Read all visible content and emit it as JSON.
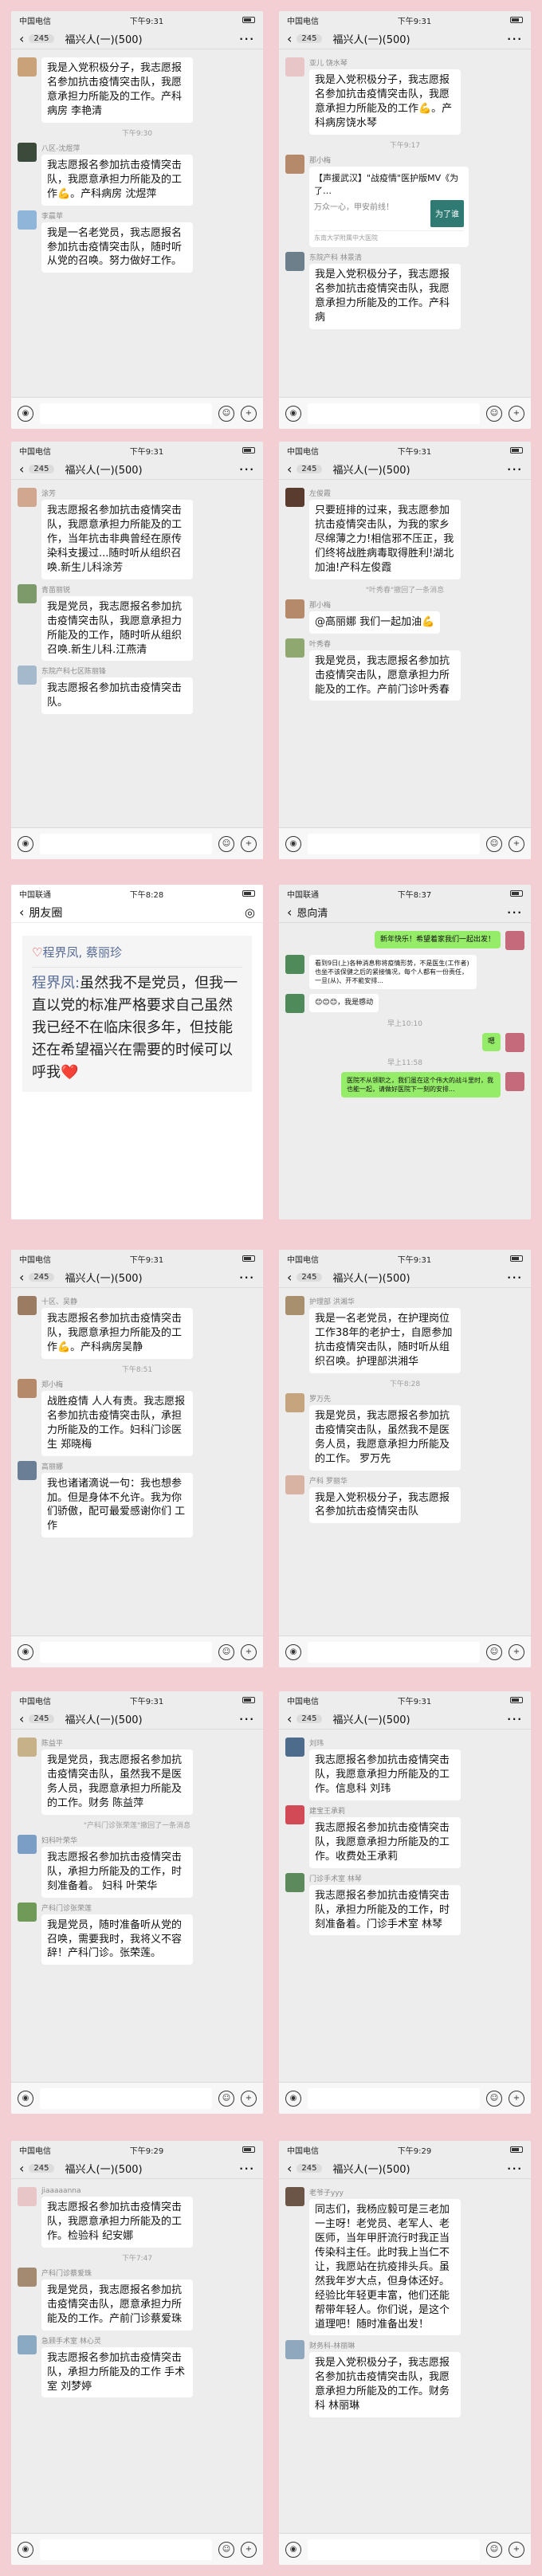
{
  "colors": {
    "background": "#f3cfd3",
    "chat_bg": "#ededed",
    "bubble": "#ffffff",
    "green_bubble": "#95ec69",
    "link": "#576b95"
  },
  "common": {
    "group_title": "福兴人(一)(500)",
    "unread": "245",
    "more": "···",
    "back": "‹",
    "voice_icon": "◉",
    "emoji_icon": "☺",
    "plus_icon": "+"
  },
  "p1": {
    "status_left": "中国电信",
    "time": "下午9:31",
    "m1": "我是入党积极分子，我志愿报名参加抗击疫情突击队，我愿意承担力所能及的工作。产科病房 李艳清",
    "ts1": "下午9:30",
    "n2": "八区-沈煜萍",
    "m2": "我志愿报名参加抗击疫情突击队，我愿意承担力所能及的工作💪。产科病房 沈煜萍",
    "n3": "李晨苹",
    "m3": "我是一名老党员，我志愿报名参加抗击疫情突击队，随时听从党的召唤。努力做好工作。"
  },
  "p2": {
    "status_left": "中国电信",
    "time": "下午9:31",
    "n1": "亚儿 饶水琴",
    "m1": "我是入党积极分子，我志愿报名参加抗击疫情突击队，我愿意承担力所能及的工作💪。产科病房饶水琴",
    "ts1": "下午9:17",
    "n2": "那小梅",
    "card_title": "【声援武汉】\"战疫情\"医护版MV《为了…",
    "card_desc": "万众一心，甲安前线！",
    "card_thumb": "为了谁",
    "card_src": "东南大学附属中大医院",
    "n3": "东院产科 林景清",
    "m3": "我是入党积极分子，我志愿报名参加抗击疫情突击队，我愿意承担力所能及的工作。产科病"
  },
  "p3": {
    "status_left": "中国电信",
    "time": "下午9:31",
    "n1": "涂芳",
    "m1": "我志愿报名参加抗击疫情突击队，我愿意承担力所能及的工作，当年抗击非典曾经在原传染科支援过...随时听从组织召唤.新生儿科涂芳",
    "n2": "青苗丽锐",
    "m2": "我是党员，我志愿报名参加抗击疫情突击队，我愿意承担力所能及的工作，随时听从组织召唤.新生儿科.江燕清",
    "n3": "东院产科七区陈丽锋",
    "m3": "我志愿报名参加抗击疫情突击队。"
  },
  "p4": {
    "status_left": "中国电信",
    "time": "下午9:31",
    "n1": "左俊霞",
    "m1": "只要班排的过来，我志愿参加抗击疫情突击队，为我的家乡尽绵薄之力!相信邪不压正，我们终将战胜病毒取得胜利!湖北加油!产科左俊霞",
    "sys1": "\"叶秀春\"撤回了一条消息",
    "n2": "那小梅",
    "m2": "@高丽娜 我们一起加油💪",
    "n3": "叶秀春",
    "m3": "我是党员，我志愿报名参加抗击疫情突击队，愿意承担力所能及的工作。产前门诊叶秀春"
  },
  "p5": {
    "status_left": "中国联通",
    "time": "下午8:28",
    "title": "朋友圈",
    "camera": "◎",
    "likes": "程界凤, 蔡丽珍",
    "commenter": "程界凤:",
    "comment": "虽然我不是党员，但我一直以党的标准严格要求自己虽然我已经不在临床很多年，但技能还在希望福兴在需要的时候可以呼我❤️"
  },
  "p6": {
    "status_left": "中国联通",
    "time": "下午8:37",
    "title": "恩向清",
    "m1": "新年快乐！希望着家我们一起出发！",
    "m2": "看到9日(上)各种消息称将疫情形势，不是医生(工作者)也坐不该保健之后的紧接情况，每个人都有一份责任，一旦(从)、开不能安排...",
    "m3": "😊😊😊，我是感动",
    "ts1": "早上10:10",
    "m4": "嗯",
    "ts2": "早上11:58",
    "m5": "医院不从领职之，我们虽在这个伟大的战斗里时，我也能一起，请做好医院下一刻的安排..."
  },
  "p7": {
    "status_left": "中国电信",
    "time": "下午9:31",
    "n1": "十区、吴静",
    "m1": "我志愿报名参加抗击疫情突击队，我愿意承担力所能及的工作💪。产科病房吴静",
    "ts1": "下午8:51",
    "n2": "郑小梅",
    "m2": "战胜疫情 人人有责。我志愿报名参加抗击疫情突击队，承担力所能及的工作。妇科门诊医生 郑晓梅",
    "n3": "高丽娜",
    "m3": "我也诸诸滴说一句：我也想参加。但是身体不允许。我为你们骄傲，配可最爱感谢你们 工作"
  },
  "p8": {
    "status_left": "中国电信",
    "time": "下午9:31",
    "n1": "护理部 洪湘华",
    "m1": "我是一名老党员，在护理岗位工作38年的老护士，自愿参加抗击疫情突击队，随时听从组织召唤。护理部洪湘华",
    "ts1": "下午8:28",
    "n2": "罗万先",
    "m2": "我是党员，我志愿报名参加抗击疫情突击队，虽然我不是医务人员，我愿意承担力所能及的工作。 罗万先",
    "n3": "产科 罗丽华",
    "m3": "我是入党积极分子，我志愿报名参加抗击疫情突击队"
  },
  "p9": {
    "status_left": "中国电信",
    "time": "下午9:31",
    "n1": "陈益平",
    "m1": "我是党员，我志愿报名参加抗击疫情突击队，虽然我不是医务人员，我愿意承担力所能及的工作。财务 陈益萍",
    "sys1": "\"产科门诊张荣莲\"撤回了一条消息",
    "n2": "妇科叶荣华",
    "m2": "我志愿报名参加抗击疫情突击队，承担力所能及的工作，时刻准备着。 妇科 叶荣华",
    "n3": "产科门诊张荣莲",
    "m3": "我是党员，随时准备听从党的召唤，需要我时，我将义不容辞！产科门诊。张荣莲。"
  },
  "p10": {
    "status_left": "中国电信",
    "time": "下午9:31",
    "n1": "刘玮",
    "m1": "我志愿报名参加抗击疫情突击队，我愿意承担力所能及的工作。信息科 刘玮",
    "n2": "建宝王承莉",
    "m2": "我志愿报名参加抗击疫情突击队，我愿意承担力所能及的工作。收费处王承莉",
    "n3": "门诊手术室 林琴",
    "m3": "我志愿报名参加抗击疫情突击队，承担力所能及的工作，时刻准备着。门诊手术室 林琴"
  },
  "p11": {
    "status_left": "中国电信",
    "time": "下午9:29",
    "n1": "jiaaaaanna",
    "m1": "我志愿报名参加抗击疫情突击队，我愿意承担力所能及的工作。检验科 纪安娜",
    "ts1": "下午7:47",
    "n2": "产科门诊蔡爱珠",
    "m2": "我是党员，我志愿报名参加抗击疫情突击队，愿意承担力所能及的工作。产前门诊蔡爱珠",
    "n3": "急顾手术室 林心灵",
    "m3": "我志愿报名参加抗击疫情突击队，承担力所能及的工作 手术室 刘梦婷"
  },
  "p12": {
    "status_left": "中国电信",
    "time": "下午9:29",
    "n1": "老爷子yyy",
    "m1": "同志们，我杨应毅可是三老加一主呀！老党员、老军人、老医师，当年甲肝流行时我正当传染科主任。此时我上当仁不让，我愿站在抗疫排头兵。虽然我年岁大点，但身体还好。经验比年轻更丰富，他们还能帮带年轻人。你们说，是这个道理吧！随时准备出发！",
    "n2": "财务科-林丽琳",
    "m2": "我是入党积极分子，我志愿报名参加抗击疫情突击队，我愿意承担力所能及的工作。财务科 林丽琳"
  }
}
